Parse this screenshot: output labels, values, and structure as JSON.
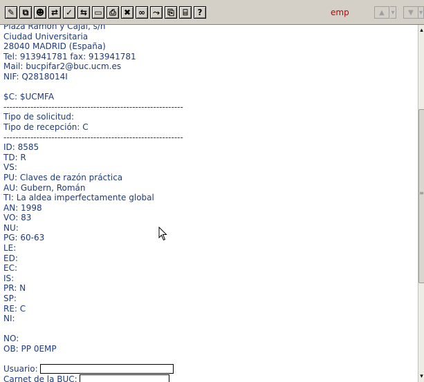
{
  "toolbar": {
    "buttons": [
      {
        "icon": "edit-icon",
        "glyph": "✎"
      },
      {
        "icon": "copy-icon",
        "glyph": "⧉"
      },
      {
        "icon": "users-icon",
        "glyph": "☻"
      },
      {
        "icon": "user-swap-icon",
        "glyph": "⇄"
      },
      {
        "icon": "check-icon",
        "glyph": "✓"
      },
      {
        "icon": "transfer-icon",
        "glyph": "⇆"
      },
      {
        "icon": "window-icon",
        "glyph": "▭"
      },
      {
        "icon": "print-icon",
        "glyph": "⎙"
      },
      {
        "icon": "delete-icon",
        "glyph": "✖"
      },
      {
        "icon": "binoculars-icon",
        "glyph": "∞"
      },
      {
        "icon": "route-icon",
        "glyph": "⤳"
      },
      {
        "icon": "paste-icon",
        "glyph": "⎘"
      },
      {
        "icon": "form-icon",
        "glyph": "⌸"
      },
      {
        "icon": "help-icon",
        "glyph": "?"
      }
    ],
    "user_label": "emp",
    "nav": {
      "up_glyph": "▲",
      "down_glyph": "▼",
      "dropdown_glyph": "▾"
    }
  },
  "content": {
    "lines": [
      "Plaza Ramón y Cajal, s/n",
      "Ciudad Universitaria",
      "28040 MADRID (España)",
      "Tel: 913941781 fax: 913941781",
      "Mail: bucpifar2@buc.ucm.es",
      "NIF: Q2818014I",
      "",
      "$C: $UCMFA",
      "------------------------------------------------------------",
      "Tipo de solicitud:",
      "Tipo de recepción: C",
      "------------------------------------------------------------",
      "ID: 8585",
      "TD: R",
      "VS:",
      "PU: Claves de razón práctica",
      "AU: Gubern, Román",
      "TI: La aldea imperfectamente global",
      "AN: 1998",
      "VO: 83",
      "NU:",
      "PG: 60-63",
      "LE:",
      "ED:",
      "EC:",
      "IS:",
      "PR: N",
      "SP:",
      "RE: C",
      "NI:",
      "",
      "NO:",
      "OB: PP 0EMP",
      ""
    ],
    "form": {
      "usuario_label": "Usuario:",
      "carnet_label": "Carnet de la BUC:",
      "usuario_value": "",
      "carnet_value": ""
    }
  },
  "scrollbar": {
    "up_glyph": "▴",
    "down_glyph": "▾",
    "grip_glyph": "≡"
  }
}
